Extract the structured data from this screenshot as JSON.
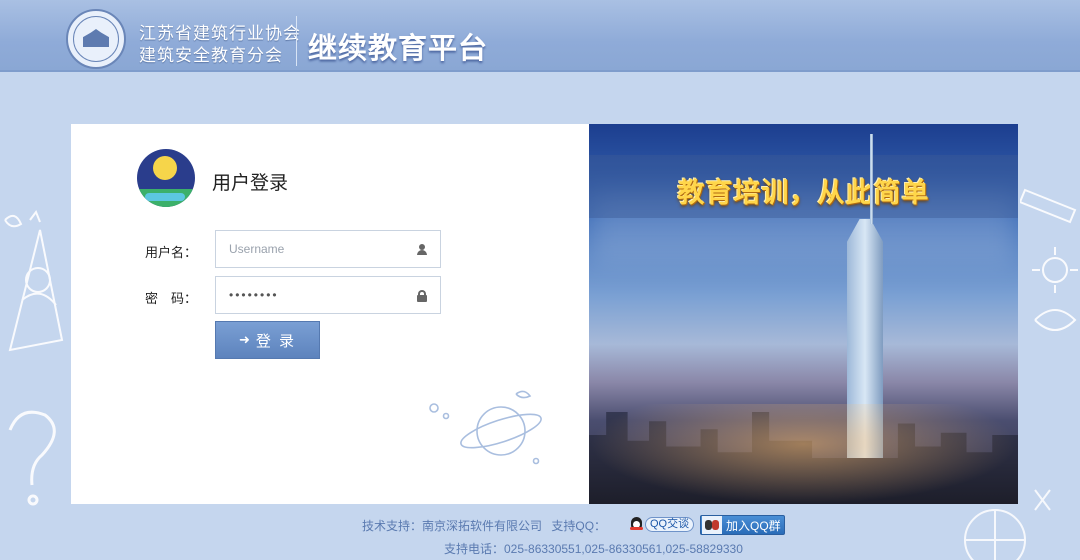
{
  "header": {
    "org_line1": "江苏省建筑行业协会",
    "org_line2": "建筑安全教育分会",
    "platform_title": "继续教育平台",
    "logo": "association-seal-logo"
  },
  "login": {
    "title": "用户登录",
    "username_label": "用户名：",
    "username_placeholder": "Username",
    "password_label": "密　码：",
    "password_value": "••••••••",
    "submit_label": "登 录",
    "submit_icon": "sign-in-icon"
  },
  "banner": {
    "slogan": "教育培训，从此简单"
  },
  "footer": {
    "tech_support": "技术支持：南京深拓软件有限公司",
    "qq_support_label": "支持QQ：",
    "qq_chat_label": "QQ交谈",
    "join_group_label": "加入QQ群",
    "phone": "支持电话：025-86330551,025-86330561,025-58829330"
  },
  "colors": {
    "background": "#c5d6ee",
    "header": "#8fabd8",
    "button": "#6a8fc8",
    "slogan": "#ffd64a",
    "footer_text": "#5a7ab0"
  }
}
